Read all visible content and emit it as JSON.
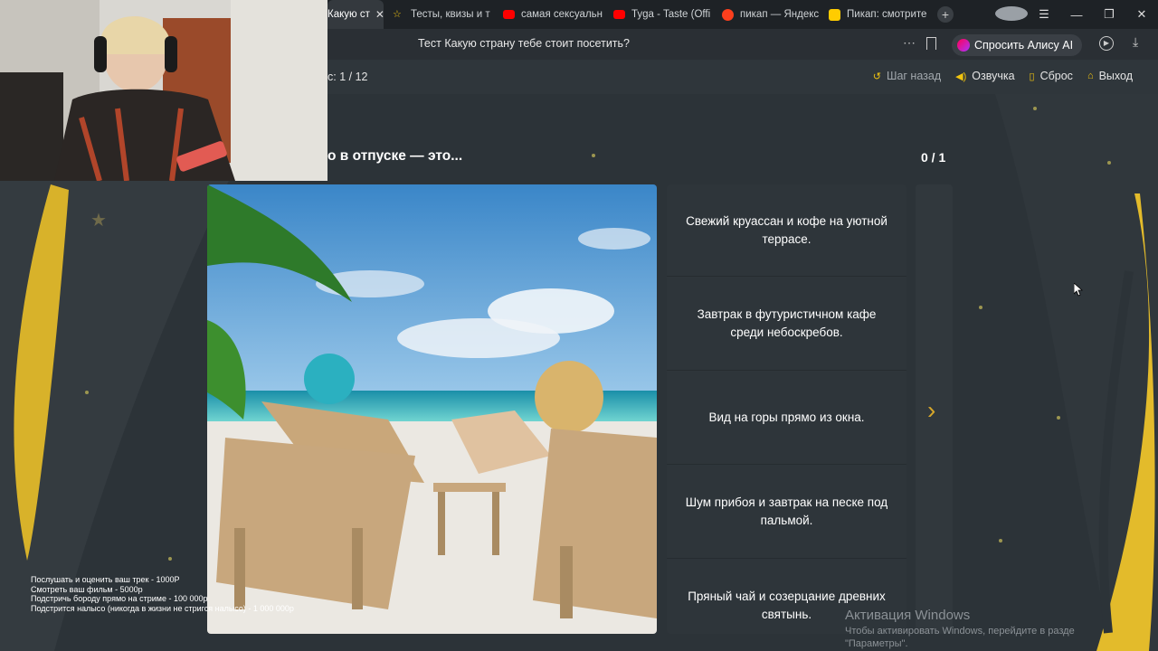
{
  "browser": {
    "tabs": [
      {
        "label": "Какую ст",
        "active": true,
        "fav_color": "#f1c40f"
      },
      {
        "label": "Тесты, квизы и т",
        "active": false,
        "fav_color": "#f1c40f"
      },
      {
        "label": "самая сексуальн",
        "active": false,
        "fav_color": "#ff0000"
      },
      {
        "label": "Tyga - Taste (Offi",
        "active": false,
        "fav_color": "#ff0000"
      },
      {
        "label": "пикап — Яндекс",
        "active": false,
        "fav_color": "#fc3f1d"
      },
      {
        "label": "Пикап: смотрите",
        "active": false,
        "fav_color": "#ffcc00"
      }
    ],
    "page_title": "Тест Какую страну тебе стоит посетить?",
    "alice_button": "Спросить Алису AI"
  },
  "quiz": {
    "progress": "с: 1 / 12",
    "actions": {
      "back": "Шаг назад",
      "voice": "Озвучка",
      "reset": "Сброс",
      "exit": "Выход"
    },
    "question": "о в отпуске — это...",
    "score": "0 / 1",
    "options": [
      "Свежий круассан и кофе на уютной террасе.",
      "Завтрак в футуристичном кафе среди небоскребов.",
      "Вид на горы прямо из окна.",
      "Шум прибоя и завтрак на песке под пальмой.",
      "Пряный чай и созерцание древних святынь."
    ]
  },
  "stream_overlay": [
    "Послушать и оценить ваш трек - 1000Р",
    "Смотреть ваш фильм - 5000р",
    "Подстричь бороду прямо на стриме - 100 000р",
    "Подстрится налысо (никогда в жизни не стригся налысо) - 1 000 000р"
  ],
  "windows_activation": {
    "title": "Активация Windows",
    "line1": "Чтобы активировать Windows, перейдите в разде",
    "line2": "\"Параметры\"."
  },
  "colors": {
    "accent": "#f1c40f",
    "background": "#2c3338",
    "panel": "#2e353a"
  }
}
